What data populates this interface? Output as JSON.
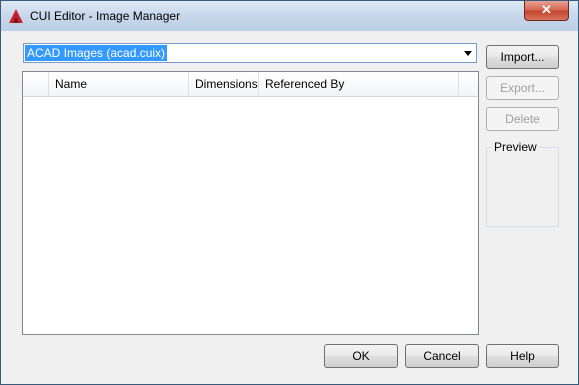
{
  "window": {
    "title": "CUI Editor - Image Manager",
    "close_glyph": "✕"
  },
  "combo": {
    "selected": "ACAD Images (acad.cuix)"
  },
  "list": {
    "columns": [
      "Name",
      "Dimensions",
      "Referenced By"
    ],
    "rows": []
  },
  "buttons": {
    "import": "Import...",
    "export": "Export...",
    "delete": "Delete",
    "ok": "OK",
    "cancel": "Cancel",
    "help": "Help"
  },
  "preview": {
    "label": "Preview"
  },
  "colors": {
    "selection": "#3399ff",
    "title_icon": "#c8202b",
    "close": "#c4452f"
  }
}
